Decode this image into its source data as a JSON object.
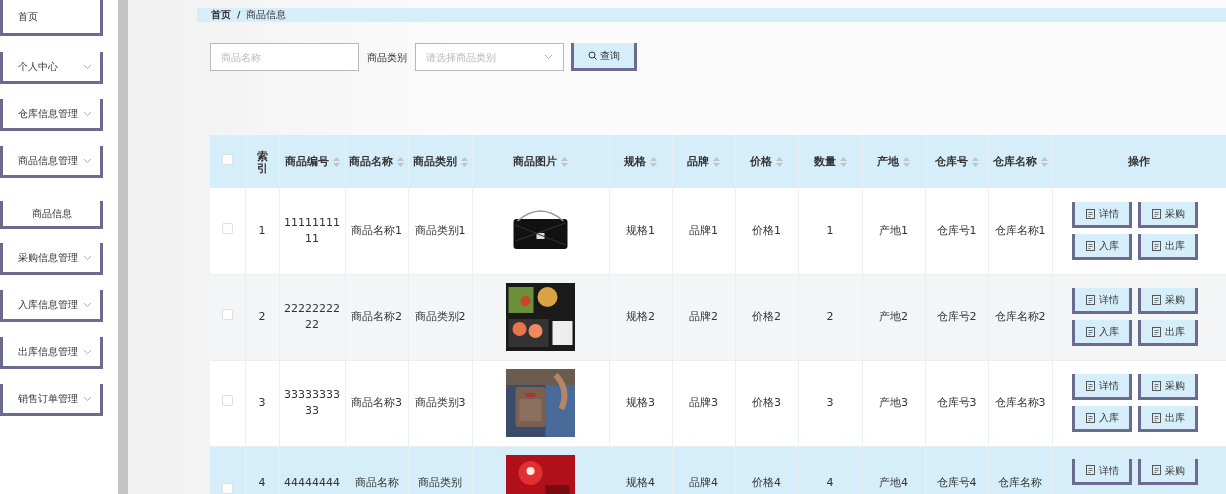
{
  "sidebar": {
    "items": [
      {
        "label": "首页",
        "expandable": false,
        "sub": false
      },
      {
        "label": "个人中心",
        "expandable": true,
        "sub": false
      },
      {
        "label": "仓库信息管理",
        "expandable": true,
        "sub": false
      },
      {
        "label": "商品信息管理",
        "expandable": true,
        "sub": false
      },
      {
        "label": "商品信息",
        "expandable": false,
        "sub": true
      },
      {
        "label": "采购信息管理",
        "expandable": true,
        "sub": false
      },
      {
        "label": "入库信息管理",
        "expandable": true,
        "sub": false
      },
      {
        "label": "出库信息管理",
        "expandable": true,
        "sub": false
      },
      {
        "label": "销售订单管理",
        "expandable": true,
        "sub": false
      }
    ]
  },
  "breadcrumb": {
    "items": [
      "首页",
      "商品信息"
    ],
    "separator": "/"
  },
  "search": {
    "name_placeholder": "商品名称",
    "category_label": "商品类别",
    "category_placeholder": "请选择商品类别",
    "button": "查询"
  },
  "table": {
    "select_all": {
      "checked": false
    },
    "columns": [
      {
        "label": "索引",
        "sortable": false
      },
      {
        "label": "商品编号",
        "sortable": true
      },
      {
        "label": "商品名称",
        "sortable": true
      },
      {
        "label": "商品类别",
        "sortable": true
      },
      {
        "label": "商品图片",
        "sortable": true
      },
      {
        "label": "规格",
        "sortable": true
      },
      {
        "label": "品牌",
        "sortable": true
      },
      {
        "label": "价格",
        "sortable": true
      },
      {
        "label": "数量",
        "sortable": true
      },
      {
        "label": "产地",
        "sortable": true
      },
      {
        "label": "仓库号",
        "sortable": true
      },
      {
        "label": "仓库名称",
        "sortable": true
      },
      {
        "label": "操作",
        "sortable": false
      }
    ],
    "rows": [
      {
        "checked": false,
        "highlighted": false,
        "cells": [
          "1",
          "1111111111",
          "商品名称1",
          "商品类别1",
          {
            "kind": "picture"
          },
          "规格1",
          "品牌1",
          "价格1",
          "1",
          "产地1",
          "仓库号1",
          "仓库名称1"
        ],
        "actions": [
          "详情",
          "采购",
          "入库",
          "出库"
        ]
      },
      {
        "checked": false,
        "highlighted": false,
        "cells": [
          "2",
          "2222222222",
          "商品名称2",
          "商品类别2",
          {
            "kind": "picture"
          },
          "规格2",
          "品牌2",
          "价格2",
          "2",
          "产地2",
          "仓库号2",
          "仓库名称2"
        ],
        "actions": [
          "详情",
          "采购",
          "入库",
          "出库"
        ]
      },
      {
        "checked": false,
        "highlighted": false,
        "cells": [
          "3",
          "3333333333",
          "商品名称3",
          "商品类别3",
          {
            "kind": "picture"
          },
          "规格3",
          "品牌3",
          "价格3",
          "3",
          "产地3",
          "仓库号3",
          "仓库名称3"
        ],
        "actions": [
          "详情",
          "采购",
          "入库",
          "出库"
        ]
      },
      {
        "checked": false,
        "highlighted": true,
        "cells": [
          "4",
          "44444444",
          "商品名称",
          "商品类别",
          {
            "kind": "picture"
          },
          "规格4",
          "品牌4",
          "价格4",
          "4",
          "产地4",
          "仓库号4",
          "仓库名称"
        ],
        "actions": [
          "详情",
          "采购"
        ]
      }
    ]
  }
}
